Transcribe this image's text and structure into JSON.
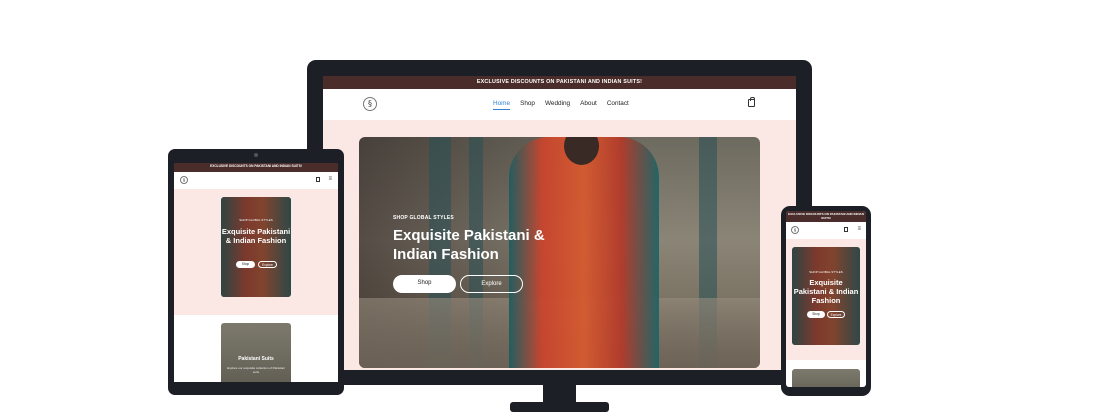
{
  "site": {
    "banner": "EXCLUSIVE DISCOUNTS ON PAKISTANI AND INDIAN SUITS!",
    "logo_glyph": "§",
    "nav": [
      "Home",
      "Shop",
      "Wedding",
      "About",
      "Contact"
    ],
    "active_nav": "Home",
    "hero": {
      "eyebrow": "SHOP GLOBAL STYLES",
      "title": "Exquisite Pakistani & Indian Fashion",
      "shop_label": "Shop",
      "explore_label": "Explore"
    },
    "category": {
      "title": "Pakistani Suits",
      "description": "Explore our exquisite collection of Pakistani suits"
    }
  },
  "colors": {
    "banner_bg": "#4a2c2a",
    "page_pink": "#fbe8e5",
    "device_frame": "#1d1f26",
    "active_link": "#2f7fd6"
  },
  "icons": {
    "logo": "brand-logo-icon",
    "cart": "shopping-bag-icon",
    "menu": "hamburger-menu-icon"
  }
}
